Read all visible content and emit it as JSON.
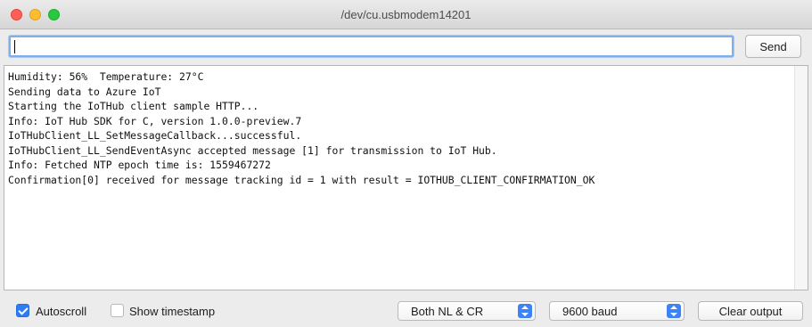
{
  "window": {
    "title": "/dev/cu.usbmodem14201"
  },
  "input": {
    "value": "",
    "placeholder": ""
  },
  "toolbar": {
    "send_label": "Send"
  },
  "output": {
    "lines": [
      "Humidity: 56%  Temperature: 27°C",
      "Sending data to Azure IoT",
      "Starting the IoTHub client sample HTTP...",
      "Info: IoT Hub SDK for C, version 1.0.0-preview.7",
      "IoTHubClient_LL_SetMessageCallback...successful.",
      "IoTHubClient_LL_SendEventAsync accepted message [1] for transmission to IoT Hub.",
      "Info: Fetched NTP epoch time is: 1559467272",
      "Confirmation[0] received for message tracking id = 1 with result = IOTHUB_CLIENT_CONFIRMATION_OK"
    ]
  },
  "bottom": {
    "autoscroll": {
      "label": "Autoscroll",
      "checked": true
    },
    "timestamp": {
      "label": "Show timestamp",
      "checked": false
    },
    "line_ending": "Both NL & CR",
    "baud": "9600 baud",
    "clear_label": "Clear output"
  },
  "icons": {
    "close": "close-traffic-light",
    "minimize": "minimize-traffic-light",
    "zoom": "zoom-traffic-light",
    "checkbox_checked": "checkmark",
    "select_stepper": "up-down-arrows"
  },
  "colors": {
    "accent": "#2f7bf5",
    "close": "#fe5f57",
    "minimize": "#febc2e",
    "zoom": "#28c840",
    "input_focus": "#7fb0ec"
  }
}
